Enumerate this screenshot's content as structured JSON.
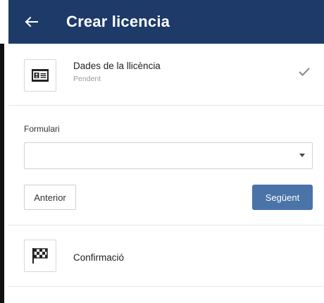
{
  "appbar": {
    "back_icon": "arrow-left-icon",
    "title": "Crear licencia",
    "background": "#1e3a68"
  },
  "steps": [
    {
      "icon": "id-card-icon",
      "title": "Dades de la llicència",
      "subtitle": "Pendent",
      "status_icon": "check-icon"
    },
    {
      "icon": "checkered-flag-icon",
      "title": "Confirmació"
    }
  ],
  "form": {
    "label": "Formulari",
    "select_value": "",
    "caret_icon": "dropdown-caret-icon"
  },
  "buttons": {
    "previous_label": "Anterior",
    "next_label": "Següent",
    "next_color": "#4a73a8"
  }
}
